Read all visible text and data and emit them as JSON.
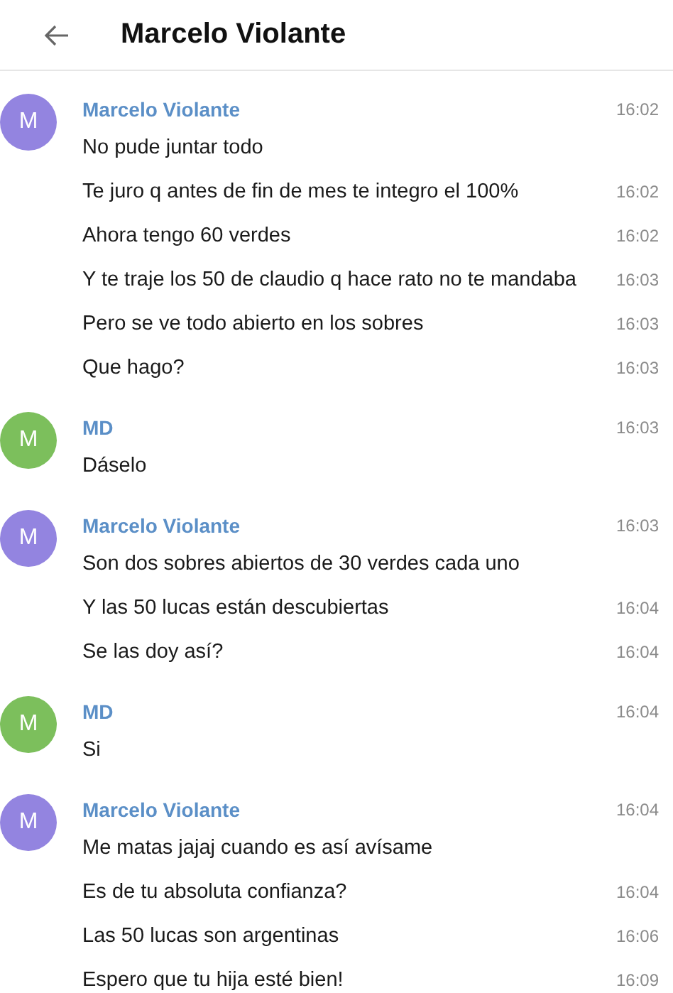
{
  "header": {
    "title": "Marcelo Violante"
  },
  "groups": [
    {
      "sender": "Marcelo Violante",
      "avatar": "M",
      "color": "#9384e0",
      "time": "16:02",
      "messages": [
        {
          "text": "No pude juntar todo"
        },
        {
          "text": "Te juro q antes de fin de mes te integro el 100%",
          "time": "16:02"
        },
        {
          "text": "Ahora tengo 60 verdes",
          "time": "16:02"
        },
        {
          "text": "Y te traje los 50 de claudio q hace rato no te mandaba",
          "time": "16:03"
        },
        {
          "text": "Pero se ve todo abierto en los sobres",
          "time": "16:03"
        },
        {
          "text": "Que hago?",
          "time": "16:03"
        }
      ]
    },
    {
      "sender": "MD",
      "avatar": "M",
      "color": "#7cbf5c",
      "time": "16:03",
      "messages": [
        {
          "text": "Dáselo"
        }
      ]
    },
    {
      "sender": "Marcelo Violante",
      "avatar": "M",
      "color": "#9384e0",
      "time": "16:03",
      "messages": [
        {
          "text": "Son dos sobres abiertos de 30 verdes cada uno"
        },
        {
          "text": "Y las 50 lucas están descubiertas",
          "time": "16:04"
        },
        {
          "text": "Se las doy así?",
          "time": "16:04"
        }
      ]
    },
    {
      "sender": "MD",
      "avatar": "M",
      "color": "#7cbf5c",
      "time": "16:04",
      "messages": [
        {
          "text": "Si"
        }
      ]
    },
    {
      "sender": "Marcelo Violante",
      "avatar": "M",
      "color": "#9384e0",
      "time": "16:04",
      "messages": [
        {
          "text": "Me matas jajaj cuando es así avísame"
        },
        {
          "text": "Es de tu absoluta confianza?",
          "time": "16:04"
        },
        {
          "text": "Las 50 lucas son argentinas",
          "time": "16:06"
        },
        {
          "text": "Espero que tu hija esté bien!",
          "time": "16:09"
        }
      ]
    }
  ]
}
